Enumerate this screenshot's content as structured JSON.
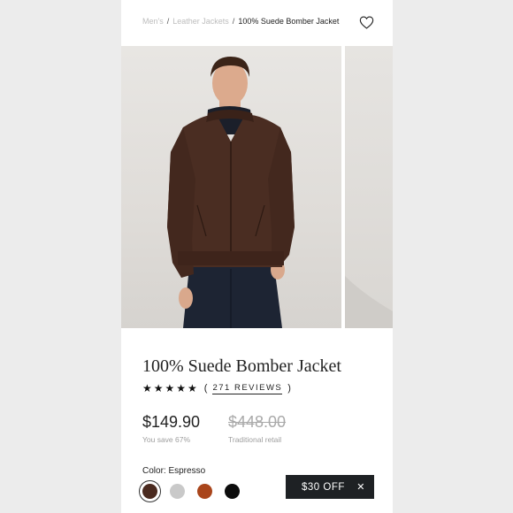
{
  "breadcrumb": {
    "items": [
      "Men's",
      "Leather Jackets"
    ],
    "separator": "/",
    "current": "100% Suede Bomber Jacket"
  },
  "product": {
    "title": "100% Suede Bomber Jacket",
    "stars": "★★★★★",
    "rating": 5,
    "reviews_open": "(",
    "reviews_label": "271 REVIEWS",
    "reviews_close": ")",
    "price": "$149.90",
    "savings": "You save 67%",
    "retail_price": "$448.00",
    "retail_label": "Traditional retail",
    "color_label": "Color: Espresso"
  },
  "swatches": [
    {
      "name": "Espresso",
      "color": "#4a2a1f",
      "selected": true
    },
    {
      "name": "Grey",
      "color": "#c9c9c9",
      "selected": false
    },
    {
      "name": "Cognac",
      "color": "#a9451b",
      "selected": false
    },
    {
      "name": "Black",
      "color": "#0c0c0c",
      "selected": false
    }
  ],
  "promo": {
    "label": "$30 OFF",
    "close": "✕"
  },
  "colors": {
    "accent_dark": "#1e2124",
    "jacket": "#4a2d22"
  },
  "icons": {
    "wishlist": "heart-icon",
    "dismiss": "close-icon"
  }
}
